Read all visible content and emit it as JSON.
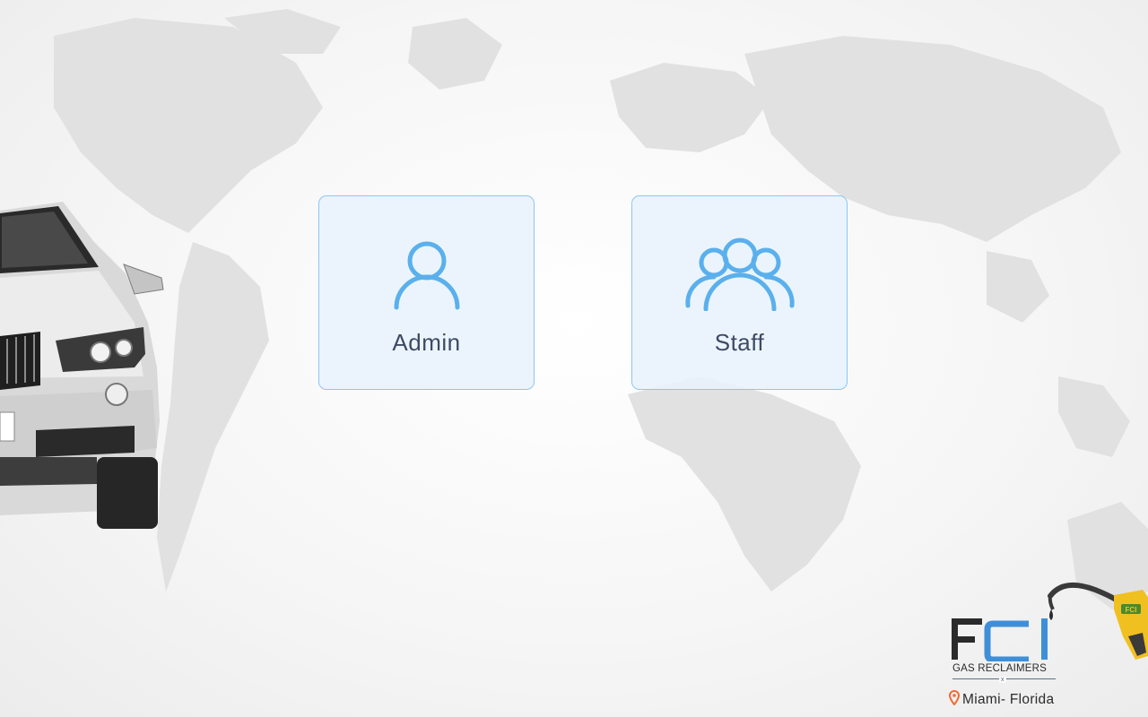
{
  "roles": [
    {
      "label": "Admin",
      "icon": "user-icon"
    },
    {
      "label": "Staff",
      "icon": "users-group-icon"
    }
  ],
  "brand": {
    "logo_text": "FCI",
    "tagline": "GAS RECLAIMERS",
    "separator": "x",
    "location": "Miami- Florida",
    "location_icon": "map-pin-icon",
    "nozzle_label": "FCI"
  },
  "colors": {
    "icon_blue": "#5ab0ec",
    "card_border": "#8ec6ef",
    "label_text": "#3d4a63",
    "logo_blue": "#3f8fd8",
    "logo_dark": "#2b2b2b",
    "pin_orange": "#f26a2e",
    "nozzle_yellow": "#f0c020"
  }
}
